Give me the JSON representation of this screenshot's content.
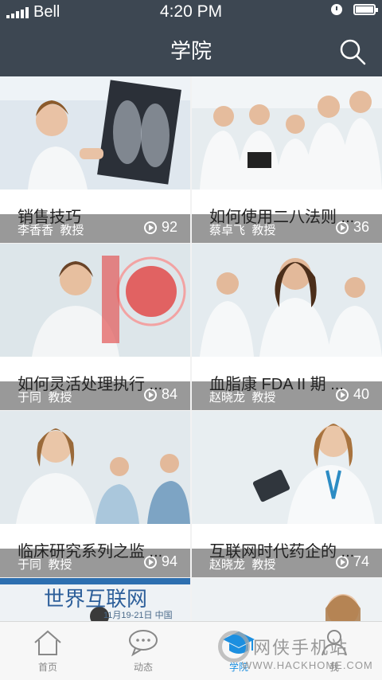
{
  "status_bar": {
    "carrier": "Bell",
    "time": "4:20 PM"
  },
  "nav": {
    "title": "学院"
  },
  "courses": [
    {
      "author": "李香香",
      "role": "教授",
      "plays": "92",
      "title": "销售技巧"
    },
    {
      "author": "蔡卓飞",
      "role": "教授",
      "plays": "36",
      "title": "如何使用二八法则 ..."
    },
    {
      "author": "于同",
      "role": "教授",
      "plays": "84",
      "title": "如何灵活处理执行 ..."
    },
    {
      "author": "赵晓龙",
      "role": "教授",
      "plays": "40",
      "title": "血脂康 FDA II 期 ..."
    },
    {
      "author": "于同",
      "role": "教授",
      "plays": "94",
      "title": "临床研究系列之监 ..."
    },
    {
      "author": "赵晓龙",
      "role": "教授",
      "plays": "74",
      "title": "互联网时代药企的 ..."
    }
  ],
  "partial_banner": {
    "text": "世界互联网",
    "date": "11月19-21日 中国"
  },
  "tabs": [
    {
      "label": "首页",
      "icon": "home-icon"
    },
    {
      "label": "动态",
      "icon": "chat-icon"
    },
    {
      "label": "学院",
      "icon": "graduation-cap-icon"
    },
    {
      "label": "我",
      "icon": "person-icon"
    }
  ],
  "watermark": {
    "text": "网侠手机站",
    "url": "WWW.HACKHOME.COM"
  },
  "colors": {
    "header": "#3d4752",
    "active_tab": "#1c8fe0"
  }
}
